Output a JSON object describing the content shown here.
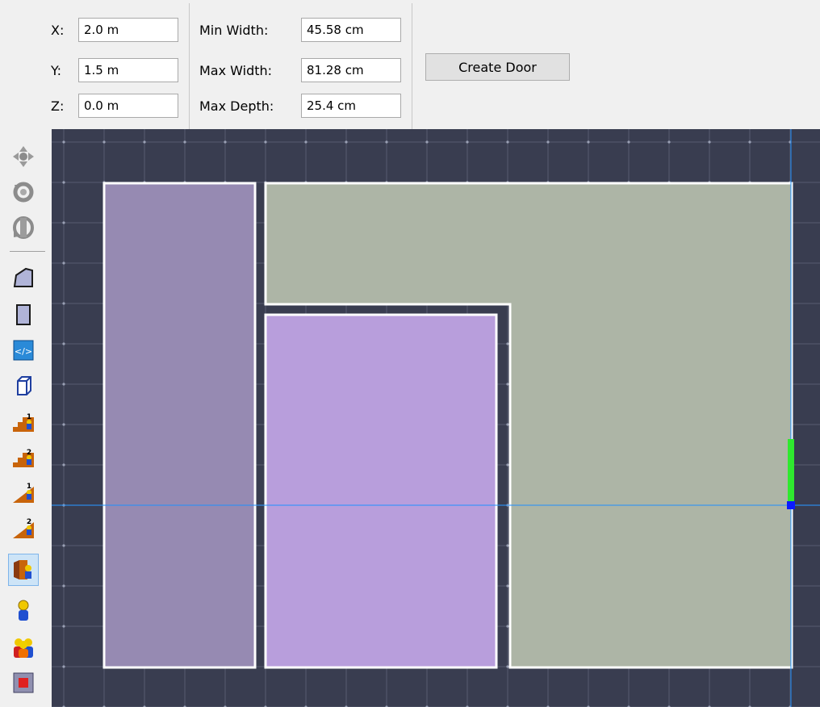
{
  "position": {
    "x_label": "X:",
    "x_value": "2.0 m",
    "y_label": "Y:",
    "y_value": "1.5 m",
    "z_label": "Z:",
    "z_value": "0.0 m"
  },
  "door_size": {
    "min_width_label": "Min Width:",
    "min_width_value": "45.58 cm",
    "max_width_label": "Max Width:",
    "max_width_value": "81.28 cm",
    "max_depth_label": "Max Depth:",
    "max_depth_value": "25.4 cm"
  },
  "actions": {
    "create_door_label": "Create Door"
  },
  "toolbar": {
    "items": [
      {
        "icon": "move-icon"
      },
      {
        "icon": "rotate-icon"
      },
      {
        "icon": "orbit-icon"
      },
      {
        "icon": "polygon-room-icon"
      },
      {
        "icon": "rectangle-room-icon"
      },
      {
        "icon": "door-icon",
        "active": false
      },
      {
        "icon": "box-icon"
      },
      {
        "icon": "stairs-1-icon"
      },
      {
        "icon": "stairs-2-icon"
      },
      {
        "icon": "ramp-1-icon"
      },
      {
        "icon": "ramp-2-icon"
      },
      {
        "icon": "door-agent-icon",
        "active": true
      },
      {
        "icon": "person-icon"
      },
      {
        "icon": "group-icon"
      },
      {
        "icon": "exit-icon"
      }
    ]
  },
  "colors": {
    "canvas_bg": "#393d50",
    "grid_line": "#4e5266",
    "room_left": "#968ab2",
    "room_center": "#b89edc",
    "room_right": "#adb5a6",
    "room_border": "#ffffff",
    "crosshair": "#1e90ff",
    "door_marker": "#2fe82f"
  }
}
